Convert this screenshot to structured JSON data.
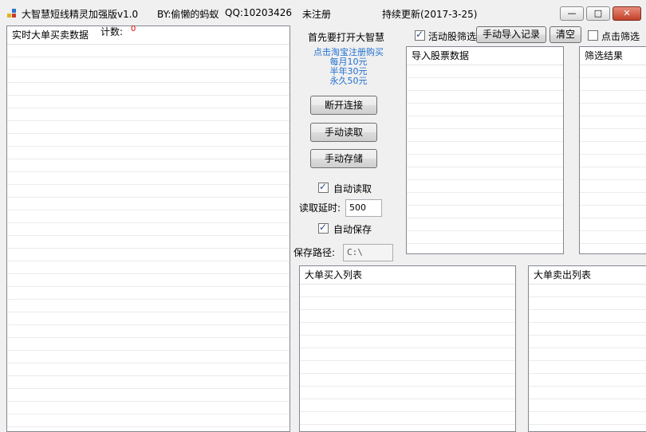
{
  "titlebar": {
    "app_name": "大智慧短线精灵加强版v1.0",
    "author": "BY:偷懒的蚂蚁",
    "qq": "QQ:10203426",
    "reg_status": "未注册",
    "update": "持续更新(2017-3-25)",
    "minimize": "—",
    "maximize": "□",
    "close": "✕"
  },
  "left_panel": {
    "header": "实时大单买卖数据"
  },
  "count": {
    "label": "计数:",
    "value": "0"
  },
  "notice": "首先要打开大智慧",
  "purchase": {
    "link": "点击淘宝注册购买",
    "monthly": "每月10元",
    "half_year": "半年30元",
    "forever": "永久50元"
  },
  "buttons": {
    "disconnect": "断开连接",
    "manual_read": "手动读取",
    "manual_save": "手动存储",
    "manual_import": "手动导入记录",
    "clear": "清空"
  },
  "auto_read": {
    "label": "自动读取",
    "checked": true
  },
  "read_delay": {
    "label": "读取延时:",
    "value": "500"
  },
  "auto_save": {
    "label": "自动保存",
    "checked": true
  },
  "save_path": {
    "label": "保存路径:",
    "value": "C:\\"
  },
  "active_filter": {
    "label": "活动股筛选",
    "checked": true
  },
  "click_filter": {
    "label": "点击筛选",
    "checked": false
  },
  "import_panel": {
    "header": "导入股票数据"
  },
  "filter_panel": {
    "header": "筛选结果"
  },
  "buy_panel": {
    "header": "大单买入列表"
  },
  "sell_panel": {
    "header": "大单卖出列表"
  }
}
